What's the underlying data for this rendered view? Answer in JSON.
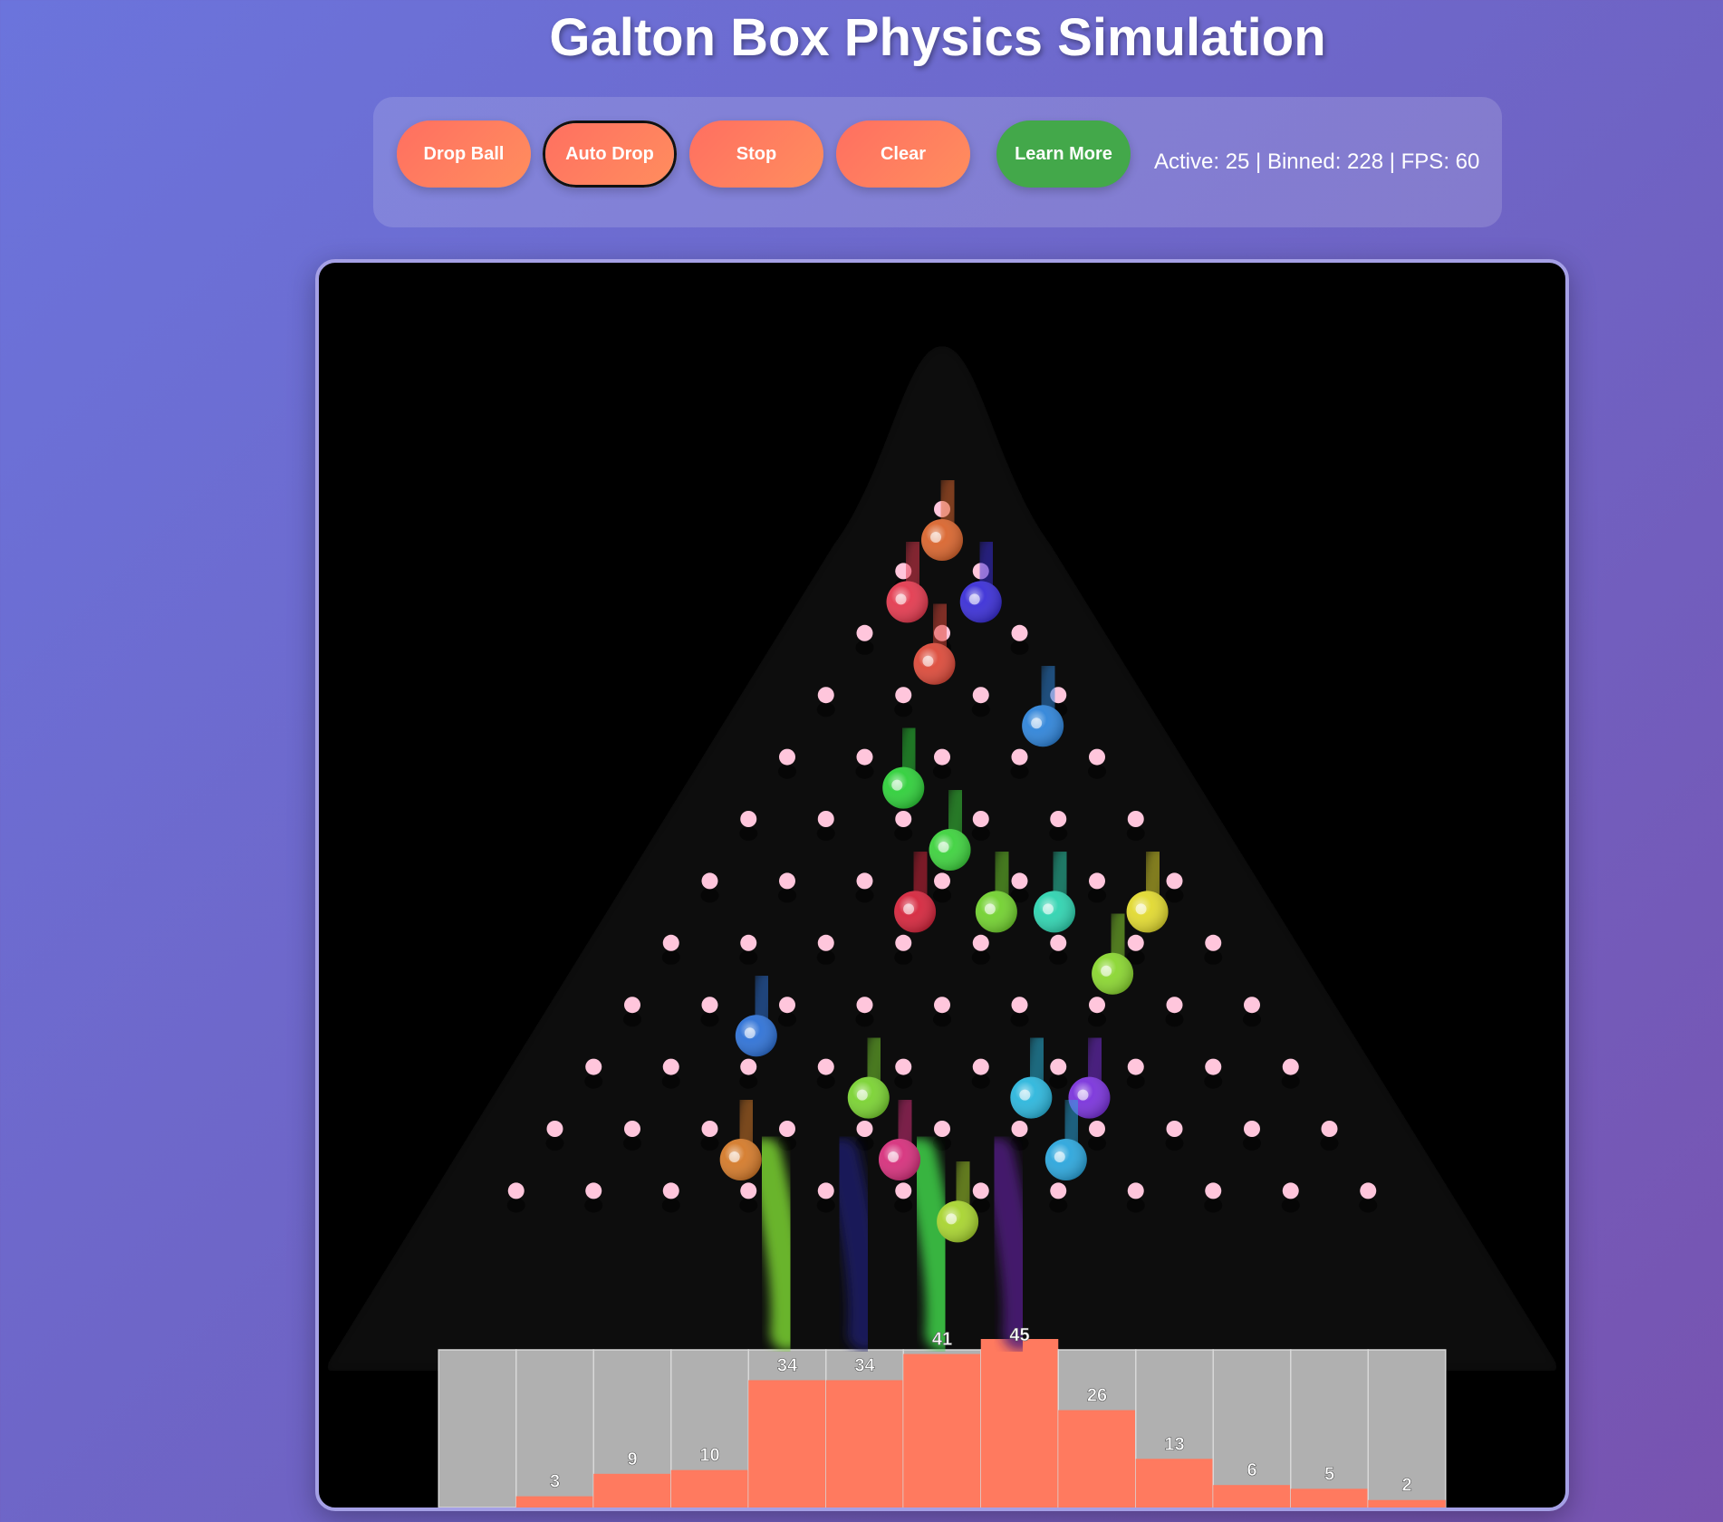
{
  "title": "Galton Box Physics Simulation",
  "controls": {
    "drop_ball": "Drop Ball",
    "auto_drop": "Auto Drop",
    "stop": "Stop",
    "clear": "Clear",
    "learn_more": "Learn More"
  },
  "stats": "Active: 25 | Binned: 228 | FPS: 60",
  "colors": {
    "button_orange": "#ff7a5f",
    "button_green": "#43a84a",
    "peg": "#ffc6dc",
    "bin_fill": "#ff7a5f",
    "bin_bg": "#b0b0b0",
    "board_bg": "#000000"
  },
  "bins": {
    "counts": [
      0,
      3,
      9,
      10,
      34,
      34,
      41,
      45,
      26,
      13,
      6,
      5,
      2
    ],
    "labels": [
      "",
      "3",
      "9",
      "10",
      "34",
      "34",
      "41",
      "45",
      "26",
      "13",
      "6",
      "5",
      "2"
    ],
    "max": 45
  },
  "pegs": {
    "rows": 12
  },
  "balls": [
    {
      "color": "#d9652e",
      "row": 0,
      "offset": 0.0
    },
    {
      "color": "#e33a4f",
      "row": 1,
      "offset": -0.45
    },
    {
      "color": "#3b2fd6",
      "row": 1,
      "offset": 0.5
    },
    {
      "color": "#dc4a3a",
      "row": 2,
      "offset": -0.1
    },
    {
      "color": "#2f84d9",
      "row": 3,
      "offset": 1.3
    },
    {
      "color": "#2fcf3a",
      "row": 4,
      "offset": -0.5
    },
    {
      "color": "#3ed23e",
      "row": 5,
      "offset": 0.1
    },
    {
      "color": "#d5263d",
      "row": 6,
      "offset": -0.35
    },
    {
      "color": "#72d12f",
      "row": 6,
      "offset": 0.7
    },
    {
      "color": "#2fd3b0",
      "row": 6,
      "offset": 1.45
    },
    {
      "color": "#e1d92f",
      "row": 6,
      "offset": 2.65
    },
    {
      "color": "#8ad630",
      "row": 7,
      "offset": 2.2
    },
    {
      "color": "#2f72d6",
      "row": 8,
      "offset": -2.4
    },
    {
      "color": "#7ad232",
      "row": 9,
      "offset": -0.95
    },
    {
      "color": "#2cb6dc",
      "row": 9,
      "offset": 1.15
    },
    {
      "color": "#7a33db",
      "row": 9,
      "offset": 1.9
    },
    {
      "color": "#d6307c",
      "row": 10,
      "offset": -0.55
    },
    {
      "color": "#d47a2a",
      "row": 10,
      "offset": -2.6
    },
    {
      "color": "#2ca6dc",
      "row": 10,
      "offset": 1.6
    },
    {
      "color": "#a8d42f",
      "row": 11,
      "offset": 0.2
    }
  ],
  "falling_streaks": [
    {
      "color": "#7ad232",
      "bin": 4
    },
    {
      "color": "#1d1e66",
      "bin": 5
    },
    {
      "color": "#3fd24a",
      "bin": 6
    },
    {
      "color": "#4d1d7c",
      "bin": 7
    }
  ]
}
